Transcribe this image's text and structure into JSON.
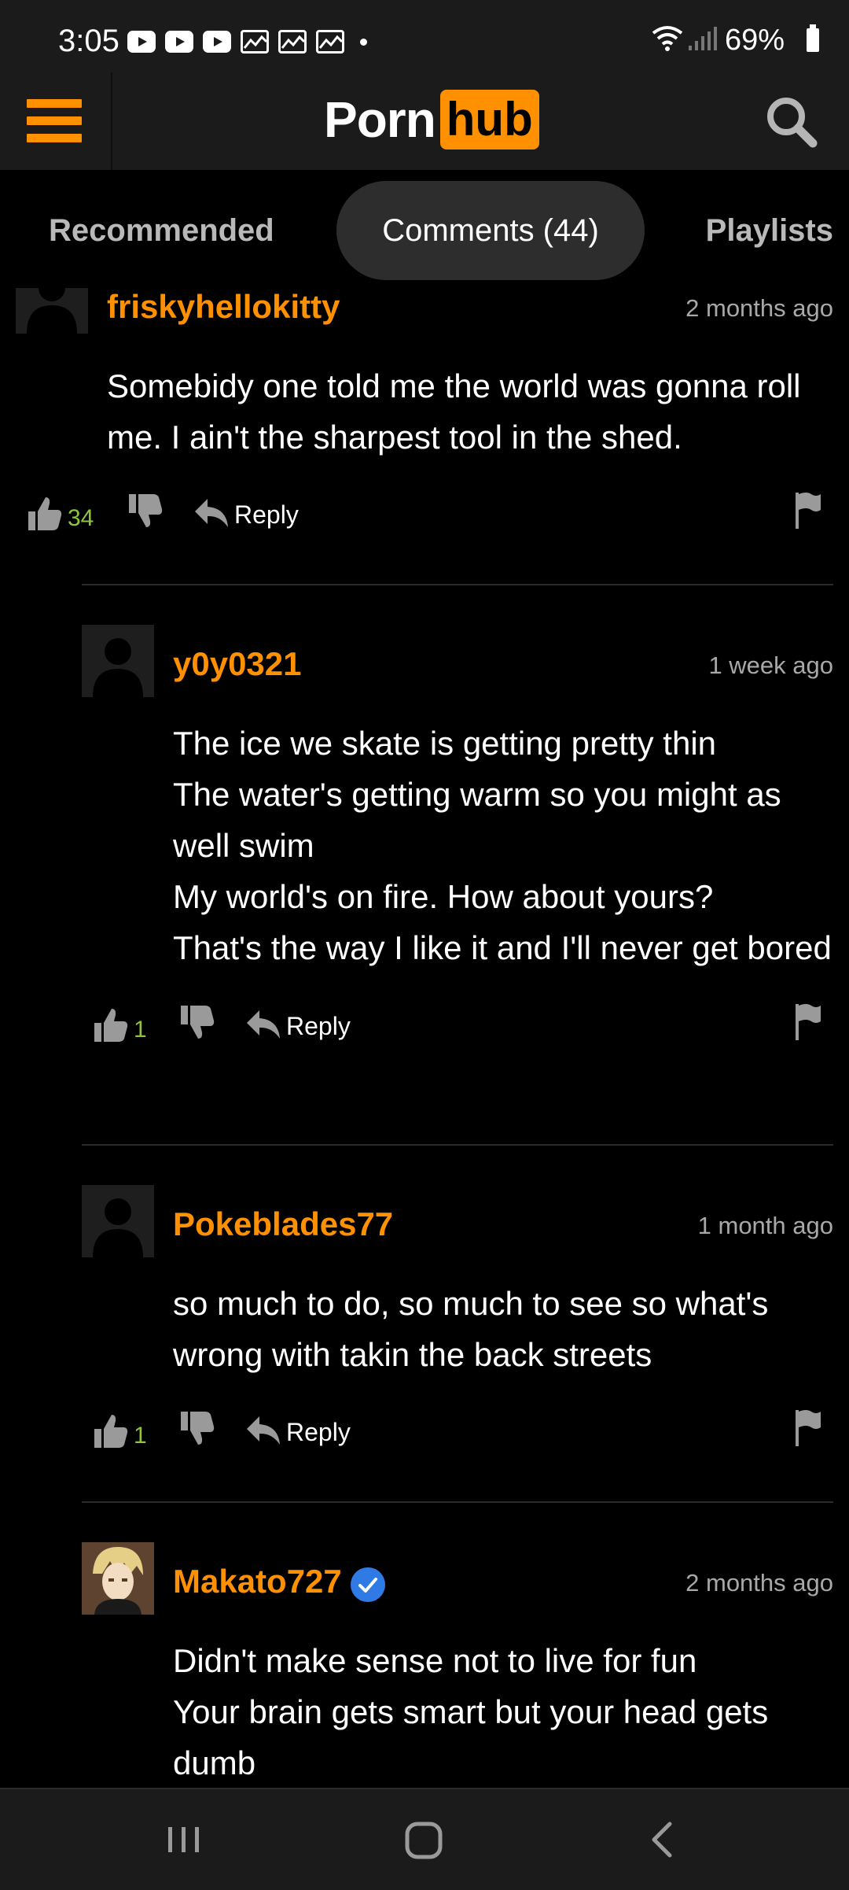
{
  "status_bar": {
    "time": "3:05",
    "battery": "69%",
    "notification_icons": [
      "youtube-icon",
      "youtube-icon",
      "youtube-icon",
      "gallery-icon",
      "gallery-icon",
      "gallery-icon"
    ]
  },
  "header": {
    "logo_part1": "Porn",
    "logo_part2": "hub",
    "brand_color": "#ff9000"
  },
  "tabs": [
    {
      "label": "Recommended",
      "active": false
    },
    {
      "label": "Comments (44)",
      "active": true
    },
    {
      "label": "Playlists",
      "active": false
    }
  ],
  "comments": [
    {
      "username": "friskyhellokitty",
      "time": "2 months ago",
      "text": "Somebidy one told me the world was gonna roll me. I ain't the sharpest tool in the shed.",
      "likes": "34",
      "reply_label": "Reply",
      "verified": false
    },
    {
      "username": "y0y0321",
      "time": "1 week ago",
      "text": "The ice we skate is getting pretty thin\nThe water's getting warm so you might as well swim\nMy world's on fire. How about yours?\nThat's the way I like it and I'll never get bored",
      "likes": "1",
      "reply_label": "Reply",
      "verified": false
    },
    {
      "username": "Pokeblades77",
      "time": "1 month ago",
      "text": "so much to do, so much to see so what's wrong with takin the back streets",
      "likes": "1",
      "reply_label": "Reply",
      "verified": false
    },
    {
      "username": "Makato727",
      "time": "2 months ago",
      "text": "Didn't make sense not to live for fun\nYour brain gets smart but your head gets dumb",
      "verified": true
    }
  ]
}
